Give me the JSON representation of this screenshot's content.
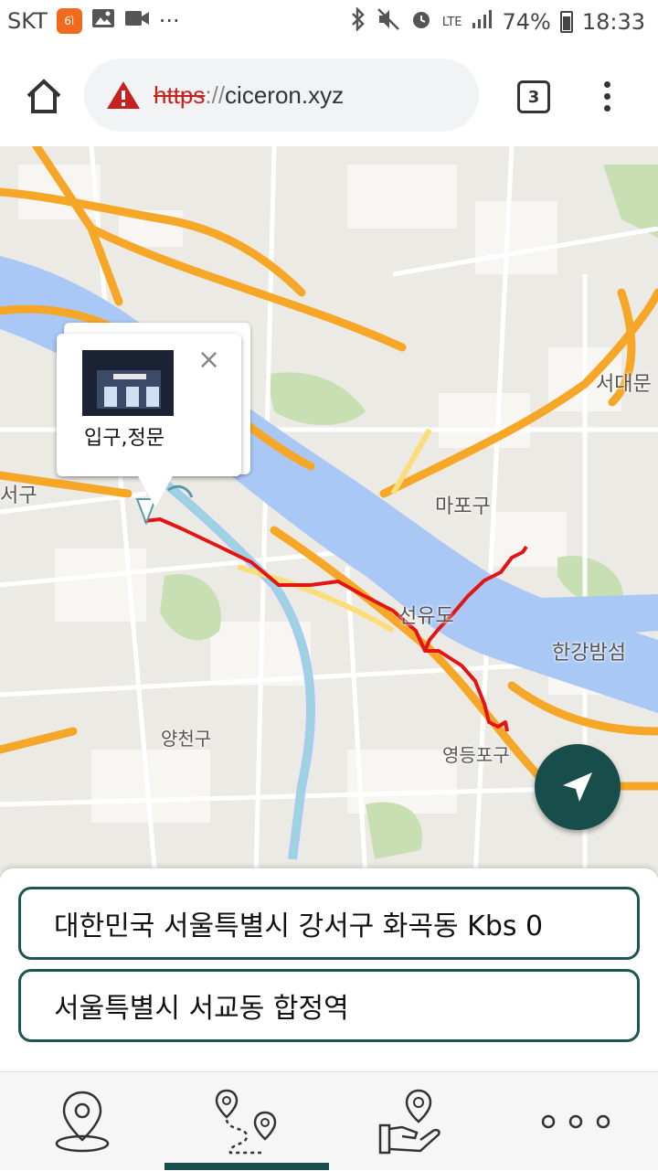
{
  "status_bar": {
    "carrier": "SKT",
    "app_badge": "6ì",
    "more": "···",
    "lte": "LTE",
    "battery": "74%",
    "time": "18:33"
  },
  "browser": {
    "url_scheme": "https",
    "url_separator": "://",
    "url_host": "ciceron.xyz",
    "tab_count": "3"
  },
  "map": {
    "labels": {
      "seodaemun": "서대문",
      "gangseo": "서구",
      "mapo": "마포구",
      "seonyudo": "선유도",
      "hangang": "한강밤섬",
      "yangcheon": "양천구",
      "yeongdeungpo": "영등포구"
    },
    "popup": {
      "title": "입구,정문",
      "close": "×"
    }
  },
  "route": {
    "from": "대한민국 서울특별시 강서구 화곡동 Kbs 0",
    "to": "서울특별시 서교동 합정역"
  },
  "colors": {
    "accent": "#174d4b",
    "route": "#e31414",
    "river": "#a9c8f5",
    "highway": "#f7a728"
  },
  "nav": {
    "items": [
      {
        "icon": "location-pin-icon",
        "active": false
      },
      {
        "icon": "route-icon",
        "active": true
      },
      {
        "icon": "hand-pin-icon",
        "active": false
      },
      {
        "icon": "more-icon",
        "active": false
      }
    ]
  }
}
